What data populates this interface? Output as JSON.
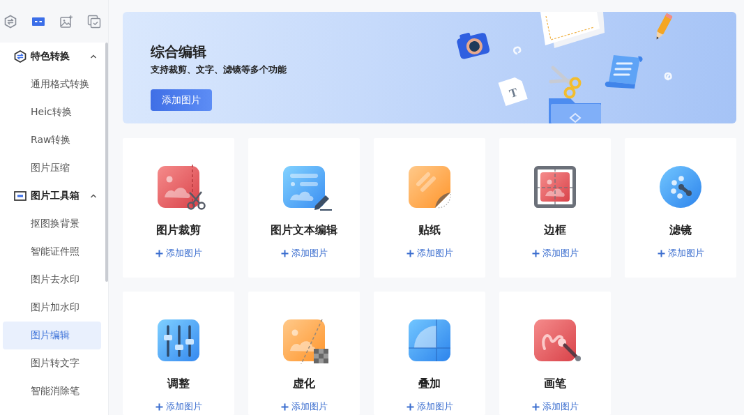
{
  "sidebar": {
    "tabs": [
      {
        "kind": "convert",
        "selected": false
      },
      {
        "kind": "toolbox",
        "selected": true
      },
      {
        "kind": "image",
        "selected": false
      },
      {
        "kind": "check",
        "selected": false
      }
    ],
    "groups": [
      {
        "kind": "convert",
        "title": "特色转换",
        "expanded": true,
        "items": [
          {
            "label": "通用格式转换",
            "selected": false
          },
          {
            "label": "Heic转换",
            "selected": false
          },
          {
            "label": "Raw转换",
            "selected": false
          },
          {
            "label": "图片压缩",
            "selected": false
          }
        ]
      },
      {
        "kind": "toolbox",
        "title": "图片工具箱",
        "expanded": true,
        "items": [
          {
            "label": "抠图换背景",
            "selected": false
          },
          {
            "label": "智能证件照",
            "selected": false
          },
          {
            "label": "图片去水印",
            "selected": false
          },
          {
            "label": "图片加水印",
            "selected": false
          },
          {
            "label": "图片编辑",
            "selected": true
          },
          {
            "label": "图片转文字",
            "selected": false
          },
          {
            "label": "智能消除笔",
            "selected": false
          }
        ]
      }
    ]
  },
  "banner": {
    "title": "综合编辑",
    "subtitle": "支持裁剪、文字、滤镜等多个功能",
    "button": "添加图片",
    "file_letter": "T"
  },
  "tools": [
    {
      "kind": "crop",
      "title": "图片裁剪",
      "action": "添加图片"
    },
    {
      "kind": "text",
      "title": "图片文本编辑",
      "action": "添加图片"
    },
    {
      "kind": "sticker",
      "title": "贴纸",
      "action": "添加图片"
    },
    {
      "kind": "frame",
      "title": "边框",
      "action": "添加图片"
    },
    {
      "kind": "filter",
      "title": "滤镜",
      "action": "添加图片"
    },
    {
      "kind": "adjust",
      "title": "调整",
      "action": "添加图片"
    },
    {
      "kind": "blur",
      "title": "虚化",
      "action": "添加图片"
    },
    {
      "kind": "overlay",
      "title": "叠加",
      "action": "添加图片"
    },
    {
      "kind": "brush",
      "title": "画笔",
      "action": "添加图片"
    }
  ]
}
